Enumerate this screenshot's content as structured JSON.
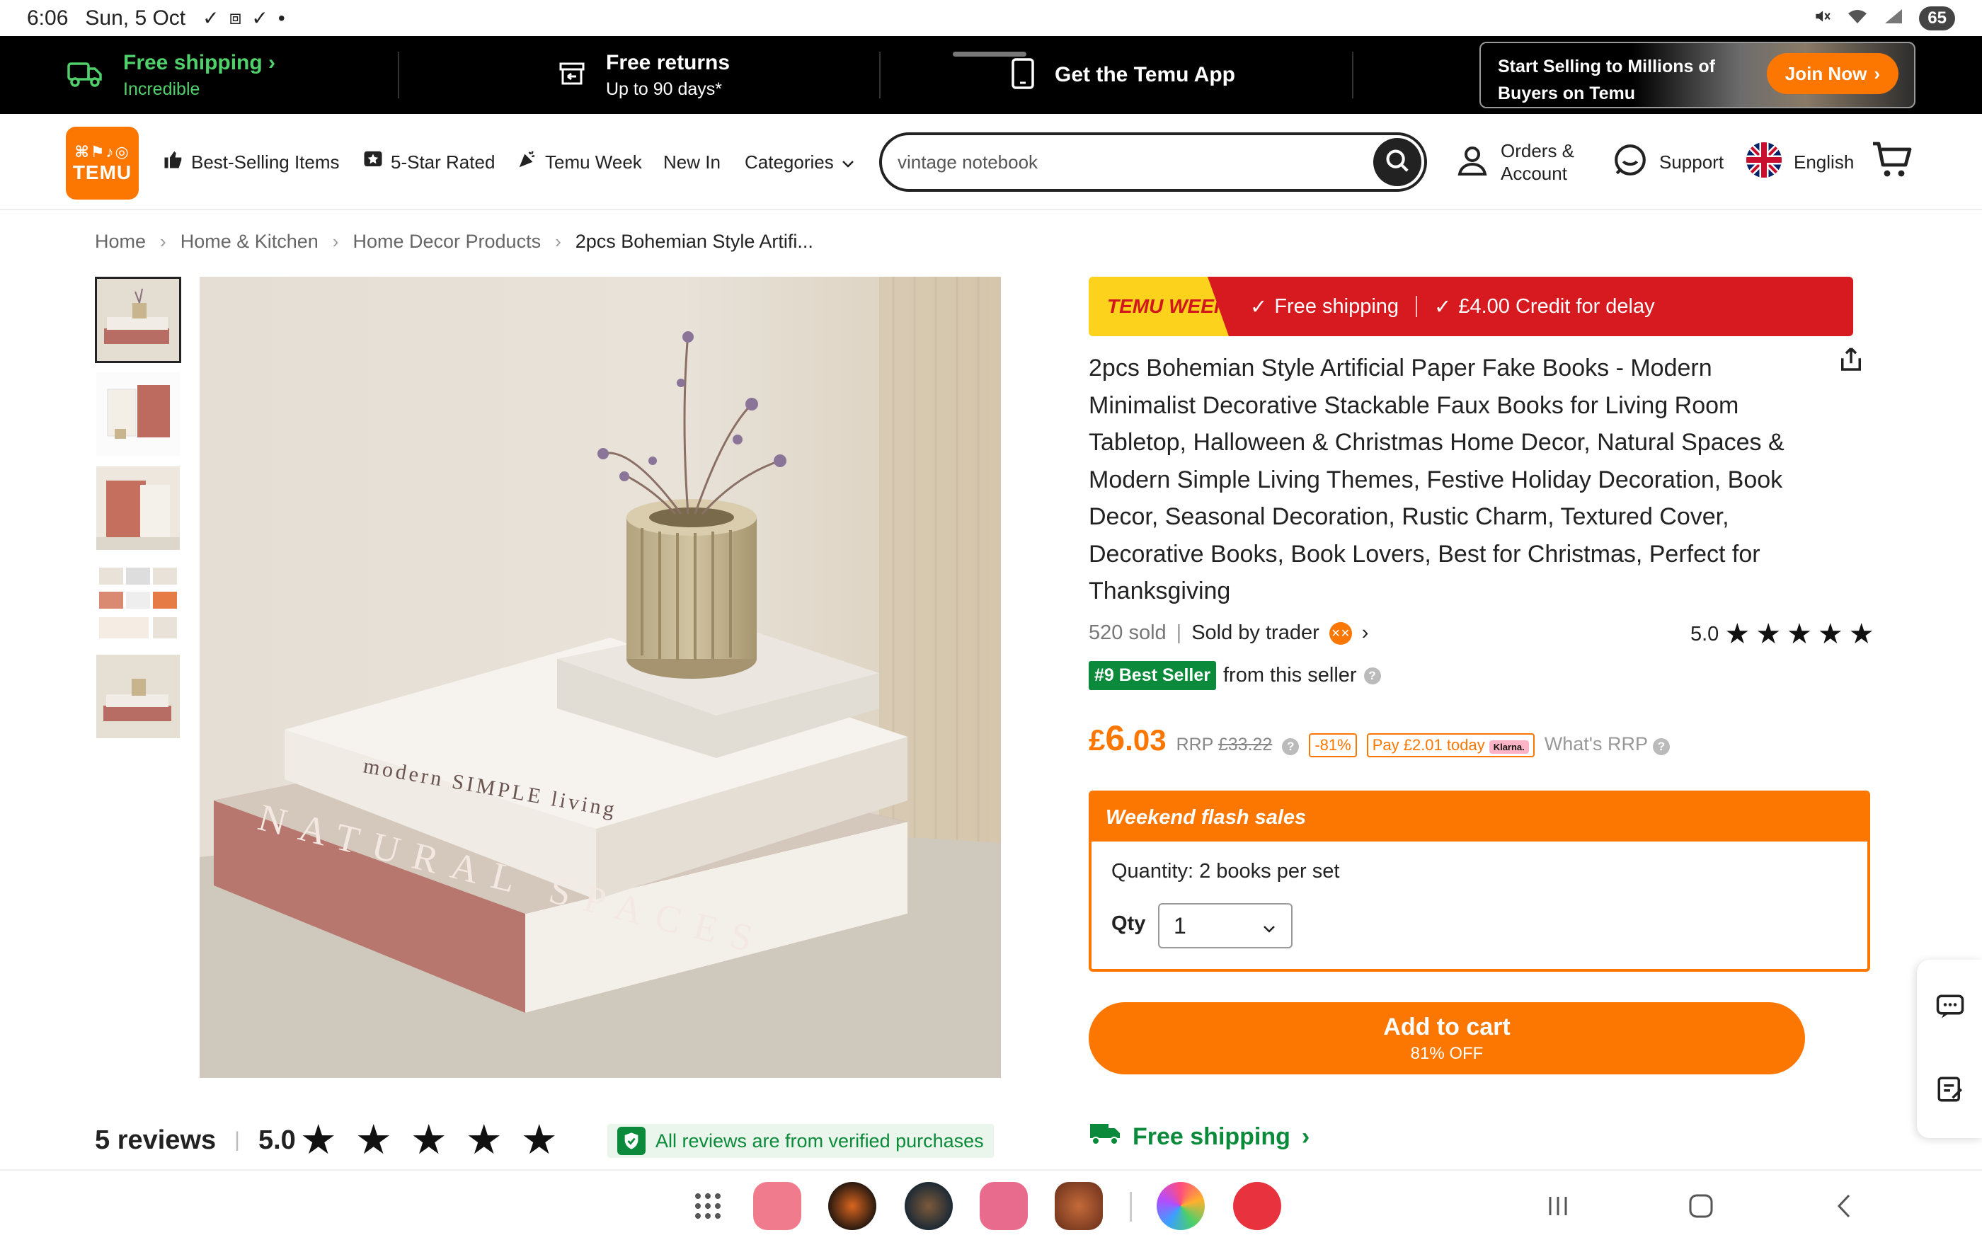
{
  "status": {
    "time": "6:06",
    "date": "Sun, 5 Oct",
    "battery": "65"
  },
  "promo": {
    "free_shipping_title": "Free shipping",
    "free_shipping_sub": "Incredible",
    "returns_title": "Free returns",
    "returns_sub": "Up to 90 days*",
    "app_title": "Get the Temu App",
    "seller_line1": "Start Selling to Millions of",
    "seller_line2": "Buyers on Temu",
    "join_label": "Join Now"
  },
  "nav": {
    "logo_text": "TEMU",
    "best_selling": "Best-Selling Items",
    "five_star": "5-Star Rated",
    "temu_week": "Temu Week",
    "new_in": "New In",
    "categories": "Categories",
    "search_value": "vintage notebook",
    "orders_line1": "Orders &",
    "orders_line2": "Account",
    "support": "Support",
    "language": "English"
  },
  "breadcrumb": [
    "Home",
    "Home & Kitchen",
    "Home Decor Products",
    "2pcs Bohemian Style Artifi..."
  ],
  "gallery": {
    "book_spine_1": "modern SIMPLE living",
    "book_spine_2": "NATURAL SPACES"
  },
  "product": {
    "banner_tag": "TEMU WEEK",
    "banner_free_shipping": "Free shipping",
    "banner_credit": "£4.00 Credit for delay",
    "title": "2pcs Bohemian Style Artificial Paper Fake Books - Modern Minimalist Decorative Stackable Faux Books for Living Room Tabletop, Halloween & Christmas Home Decor, Natural Spaces & Modern Simple Living Themes, Festive Holiday Decoration, Book Decor, Seasonal Decoration, Rustic Charm, Textured Cover, Decorative Books, Book Lovers, Best for Christmas, Perfect for Thanksgiving",
    "sold": "520 sold",
    "sold_by": "Sold by trader",
    "rating": "5.0",
    "best_seller_badge": "#9 Best Seller",
    "best_seller_suffix": "from this seller",
    "price_symbol": "£",
    "price_int": "6",
    "price_dec": ".03",
    "rrp_label": "RRP",
    "rrp_value": "£33.22",
    "discount": "-81%",
    "pay_today": "Pay £2.01 today",
    "klarna": "Klarna.",
    "whats_rrp": "What's RRP",
    "flash_title": "Weekend flash sales",
    "quantity_text": "Quantity: 2 books per set",
    "qty_label": "Qty",
    "qty_value": "1",
    "add_to_cart": "Add to cart",
    "add_to_cart_sub": "81% OFF",
    "free_shipping_row": "Free shipping"
  },
  "reviews": {
    "count": "5 reviews",
    "score": "5.0",
    "verified": "All reviews are from verified purchases"
  },
  "colors": {
    "accent": "#fb7701",
    "green": "#0a8a3a",
    "red": "#d71920",
    "yellow": "#fcd21c"
  }
}
